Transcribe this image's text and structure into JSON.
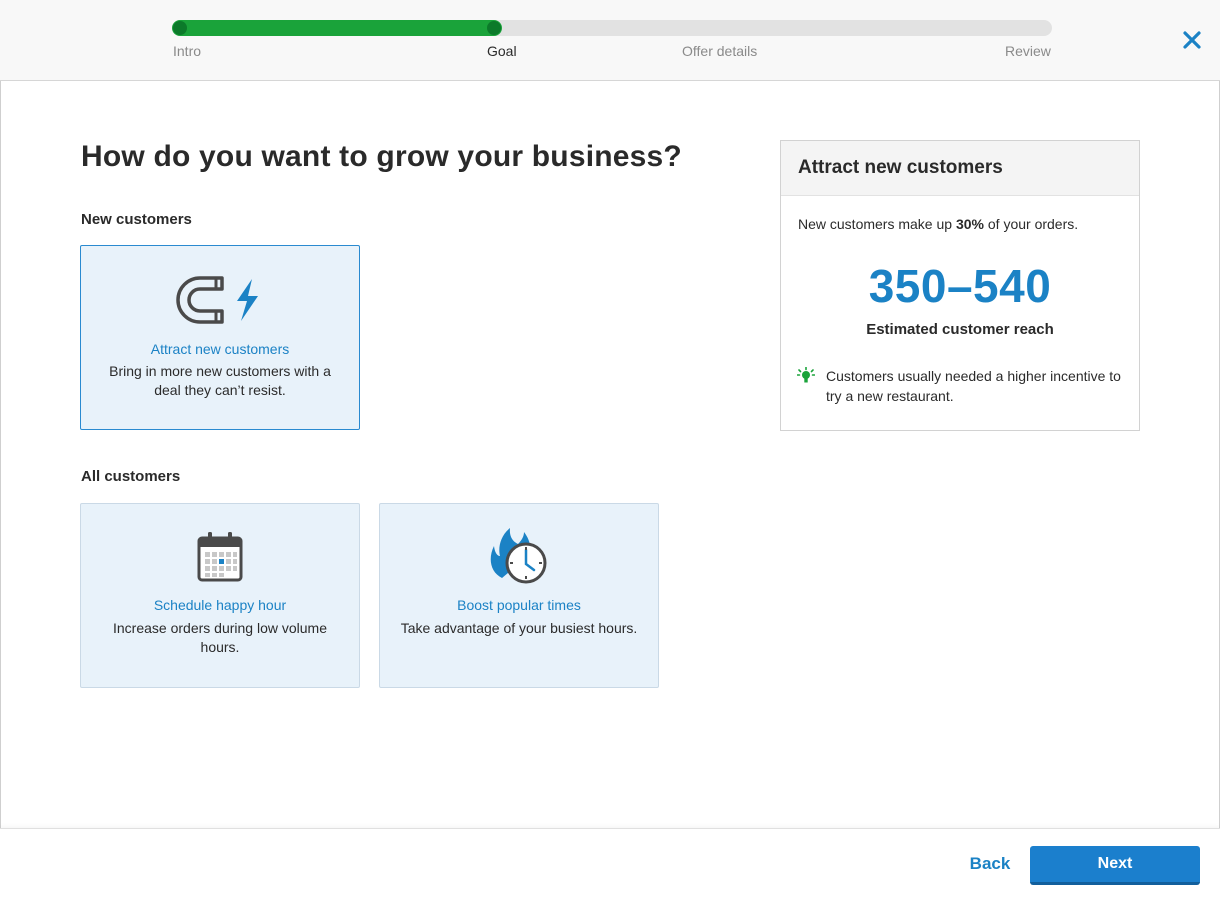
{
  "progress": {
    "steps": [
      "Intro",
      "Goal",
      "Offer details",
      "Review"
    ],
    "current_step": "Goal",
    "completed_fraction": 0.375
  },
  "header": {
    "close_icon": "close-icon"
  },
  "main": {
    "title": "How do you want to grow your business?",
    "sections": [
      {
        "label": "New customers",
        "options": [
          {
            "icon": "magnet-icon",
            "title": "Attract new customers",
            "description": "Bring in more new customers with a deal they can’t resist.",
            "selected": true
          }
        ]
      },
      {
        "label": "All customers",
        "options": [
          {
            "icon": "calendar-icon",
            "title": "Schedule happy hour",
            "description": "Increase orders during low volume hours.",
            "selected": false
          },
          {
            "icon": "flame-clock-icon",
            "title": "Boost popular times",
            "description": "Take advantage of your busiest hours.",
            "selected": false
          }
        ]
      }
    ]
  },
  "panel": {
    "title": "Attract new customers",
    "share_prefix": "New customers make up ",
    "share_value": "30%",
    "share_suffix": " of your orders.",
    "reach_value": "350–540",
    "reach_label": "Estimated customer reach",
    "tip_icon": "lightbulb-icon",
    "tip": "Customers usually needed a higher incentive to try a new restaurant."
  },
  "footer": {
    "back_label": "Back",
    "next_label": "Next"
  },
  "colors": {
    "accent": "#1b82c5",
    "progress": "#1aa33a",
    "card_bg": "#e8f2fa"
  }
}
